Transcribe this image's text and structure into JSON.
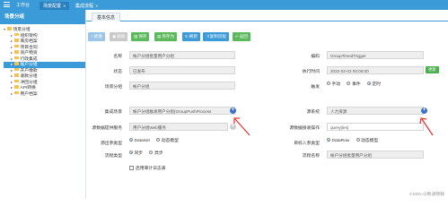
{
  "topbar": {
    "tabs": [
      {
        "label": "工作台",
        "active": false
      },
      {
        "label": "场景配置",
        "active": true
      },
      {
        "label": "集成流程",
        "active": false
      }
    ]
  },
  "sidebar": {
    "title": "场景分组",
    "root": "场景分组",
    "items": [
      "组织架构",
      "库房档案",
      "项目合同",
      "资产物资",
      "行政集成",
      "账户分组",
      "开户缴款",
      "收款分组",
      "冲回分组",
      "API转换",
      "用户档案"
    ],
    "selected_index": 5
  },
  "subtab": {
    "label": "基本信息"
  },
  "toolbar": {
    "buttons": [
      {
        "label": "新增",
        "icon": "plus-icon",
        "color": "#9bc5e6"
      },
      {
        "label": "删除",
        "icon": "trash-icon",
        "color": "#c9c9c9"
      },
      {
        "label": "保存",
        "icon": "save-icon",
        "color": "#5cb85c"
      },
      {
        "label": "另存为",
        "icon": "save-as-icon",
        "color": "#5cb85c"
      },
      {
        "label": "刷新",
        "icon": "refresh-icon",
        "color": "#3b9ad8"
      },
      {
        "label": "复制流程",
        "icon": "copy-icon",
        "color": "#3b9ad8"
      },
      {
        "label": "返回",
        "icon": "back-icon",
        "color": "#5cb85c"
      }
    ]
  },
  "form": {
    "name_label": "名称",
    "name_value": "帐户分组批量用户分组",
    "code_label": "编码",
    "code_value": "GroupTimedTrigger",
    "status_label": "状态",
    "status_value": "已发布",
    "exec_time_label": "执行时间",
    "exec_time_value": "2022-02-02 00:00:00",
    "exec_btn": "更新",
    "group_label": "场景分组",
    "group_value": "帐户分组",
    "trigger_label": "触发",
    "trigger_options": [
      "手动",
      "事件",
      "定时"
    ],
    "trigger_selected": 2,
    "integ_label": "集成场景",
    "integ_value": "帐户分组触发用户分组(GroupPushProcess",
    "source_label": "源系统",
    "source_value": "人力资源",
    "src_iface_label": "源数据提供服务",
    "src_iface_value": "用户分组Web服务",
    "tgt_op_label": "源数据接收操作",
    "tgt_op_value": "query(les)",
    "src_type_label": "源出参类型",
    "src_type_options": [
      "DataSet",
      "动态模型"
    ],
    "src_type_selected": 0,
    "tgt_type_label": "目标入参类型",
    "tgt_type_options": [
      "DataRow",
      "动态模型"
    ],
    "tgt_type_selected": 0,
    "flow_type_label": "流程类型",
    "flow_type_options": [
      "同步",
      "异步"
    ],
    "flow_type_selected": 0,
    "flow_name_label": "流程名称",
    "flow_name_value": "帐户分组批量用户分组",
    "log_label": "启用审计日志表"
  },
  "watermark": "CSDN @数通畅联"
}
